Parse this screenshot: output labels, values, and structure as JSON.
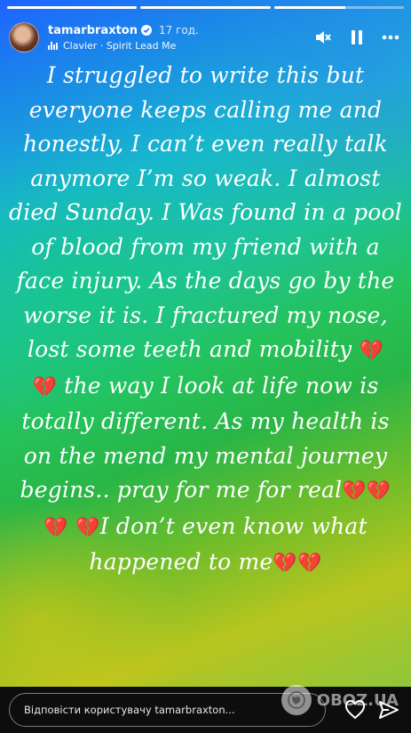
{
  "progress": [
    {
      "fill": 1.0
    },
    {
      "fill": 1.0
    },
    {
      "fill": 0.55
    }
  ],
  "header": {
    "username": "tamarbraxton",
    "time": "17 год.",
    "music": "Clavier · Spirit Lead Me",
    "icons": [
      "mute-icon",
      "pause-icon",
      "more-icon"
    ]
  },
  "story": {
    "p1": "I struggled to write this but everyone keeps calling me and honestly, I can’t even really talk anymore I’m so weak. I almost died Sunday. I Was found in a pool of blood from my friend with a face injury. As the days go by the worse it is. I fractured my nose, lost some teeth and mobility ",
    "p2": " the way I look at life now is totally different. As my health is on the mend my mental journey begins.. pray for me for real",
    "p3": "I  don’t even know what happened to me",
    "emoji": "💔"
  },
  "footer": {
    "reply_placeholder": "Відповісти користувачу tamarbraxton...",
    "icons": [
      "heart-icon",
      "send-icon"
    ]
  },
  "watermark": {
    "text": "OBOZ.UA"
  },
  "colors": {
    "gradient_top": "#1e63ff",
    "gradient_mid": "#25c25b",
    "gradient_bottom": "#b8c51f",
    "heart": "#e0152f"
  }
}
